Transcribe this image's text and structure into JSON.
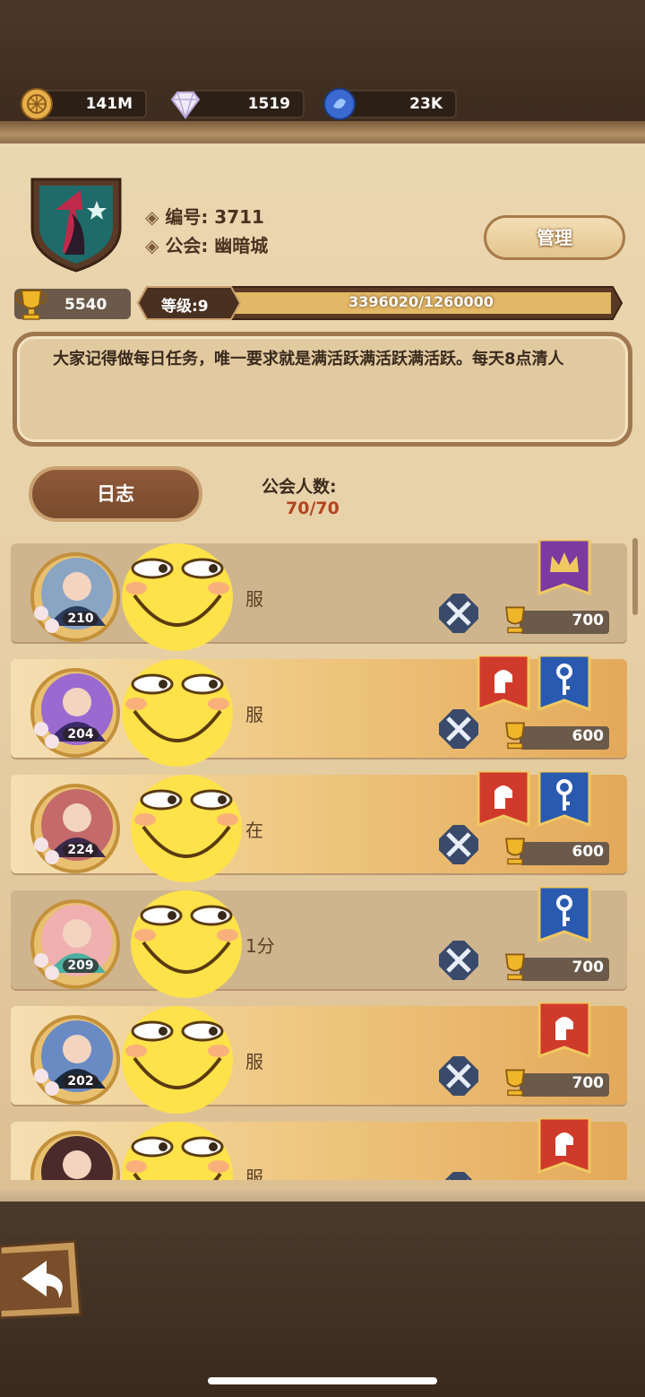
{
  "resources": {
    "gold": "141M",
    "diamonds": "1519",
    "gems": "23K"
  },
  "guild": {
    "id_label": "编号: 3711",
    "name_label": "公会: 幽暗城",
    "manage_label": "管理",
    "trophies": "5540",
    "level_label": "等级:9",
    "exp": "3396020/1260000",
    "exp_fraction": 1.0,
    "notice": "大家记得做每日任务，唯一要求就是满活跃满活跃满活跃。每天8点清人",
    "log_label": "日志",
    "member_count_label": "公会人数:",
    "member_count": "70/70"
  },
  "members": [
    {
      "level": "210",
      "name_fragment": "服",
      "trophies": "700",
      "banners": [
        "purple-crown"
      ],
      "style": "plain"
    },
    {
      "level": "204",
      "name_fragment": "服",
      "trophies": "600",
      "banners": [
        "red-helmet",
        "blue-key"
      ],
      "style": "gold"
    },
    {
      "level": "224",
      "name_fragment": "在",
      "trophies": "600",
      "banners": [
        "red-helmet",
        "blue-key"
      ],
      "style": "gold"
    },
    {
      "level": "209",
      "name_fragment": "1分",
      "trophies": "700",
      "banners": [
        "blue-key"
      ],
      "style": "plain"
    },
    {
      "level": "202",
      "name_fragment": "服",
      "trophies": "700",
      "banners": [
        "red-helmet"
      ],
      "style": "gold"
    },
    {
      "level": "",
      "name_fragment": "服",
      "trophies": "",
      "banners": [
        "red-helmet"
      ],
      "style": "gold"
    }
  ],
  "colors": {
    "accent": "#b0451f",
    "panel": "#e8d1a8",
    "frame": "#3b2a1d"
  }
}
